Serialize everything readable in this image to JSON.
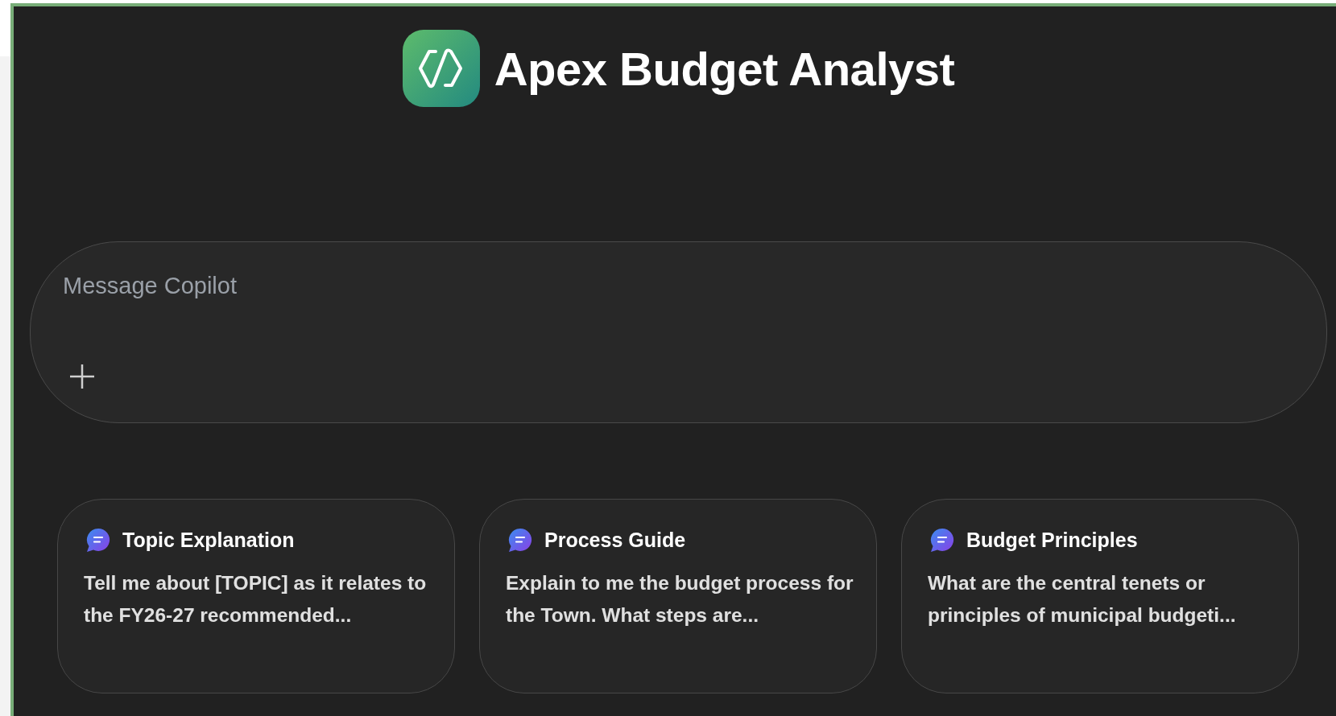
{
  "header": {
    "title": "Apex Budget Analyst"
  },
  "composer": {
    "placeholder": "Message Copilot"
  },
  "prompts": [
    {
      "title": "Topic Explanation",
      "description": "Tell me about [TOPIC] as it relates to the FY26-27 recommended..."
    },
    {
      "title": "Process Guide",
      "description": "Explain to me the budget process for the Town. What steps are..."
    },
    {
      "title": "Budget Principles",
      "description": "What are the central tenets or principles of municipal budgeti..."
    }
  ]
}
